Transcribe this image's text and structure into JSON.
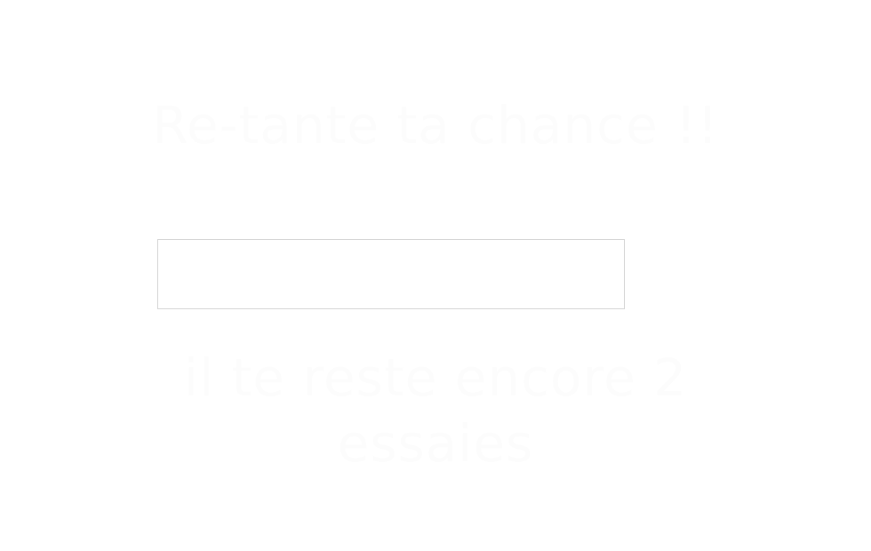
{
  "headline": "Re-tante ta chance !!",
  "guess_input": {
    "value": "",
    "placeholder": ""
  },
  "attempts_message": "il te reste encore 2 essaies",
  "colors": {
    "background": "#ffffff",
    "text": "#fcfcfc",
    "input_border": "#d7d7d7"
  }
}
